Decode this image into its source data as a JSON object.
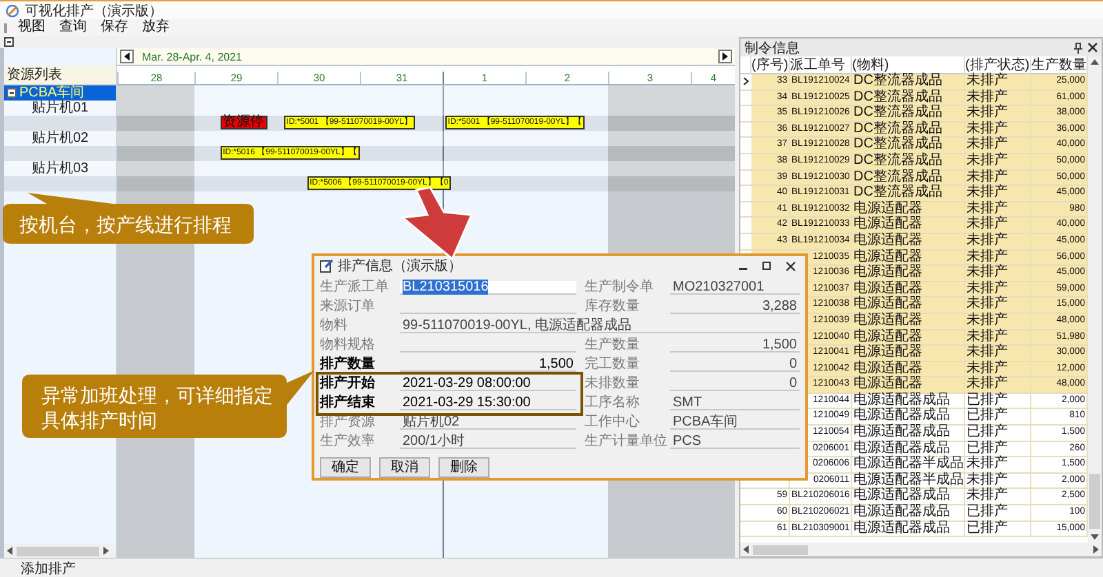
{
  "window": {
    "title": "可视化排产（演示版）"
  },
  "menu": [
    {
      "label": "视图"
    },
    {
      "label": "查询"
    },
    {
      "label": "保存"
    },
    {
      "label": "放弃"
    }
  ],
  "gantt": {
    "range": "Mar. 28-Apr. 4, 2021",
    "resource_header": "资源列表",
    "days": [
      {
        "label": "28",
        "shaded": true,
        "current": false
      },
      {
        "label": "29",
        "shaded": false,
        "current": false
      },
      {
        "label": "30",
        "shaded": false,
        "current": false
      },
      {
        "label": "31",
        "shaded": false,
        "current": false
      },
      {
        "label": "1",
        "shaded": false,
        "current": true
      },
      {
        "label": "2",
        "shaded": false,
        "current": false
      },
      {
        "label": "3",
        "shaded": true,
        "current": false
      },
      {
        "label": "4",
        "shaded": true,
        "current": false
      }
    ],
    "resources": [
      {
        "label": "PCBA车间",
        "selected": true,
        "expanded": true,
        "children": [
          {
            "label": "贴片机01",
            "selected": false,
            "bars": [
              {
                "kind": "stop",
                "label": "资源停"
              },
              {
                "kind": "job",
                "label": "ID:*5001 【99-511070019-00YL】"
              },
              {
                "kind": "job",
                "label": "ID:*5001 【99-511070019-00YL】【"
              }
            ]
          },
          {
            "label": "贴片机02",
            "selected": false,
            "bars": [
              {
                "kind": "job",
                "label": "ID:*5016 【99-511070019-00YL】【"
              }
            ]
          },
          {
            "label": "贴片机03",
            "selected": false,
            "bars": [
              {
                "kind": "job",
                "label": "ID:*5006 【99-511070019-00YL】【0"
              }
            ]
          }
        ]
      }
    ]
  },
  "callouts": [
    {
      "text": "按机台，按产线进行排程"
    },
    {
      "text": "异常加班处理，可详细指定具体排产时间"
    }
  ],
  "dialog": {
    "title": "排产信息（演示版）",
    "rows": [
      {
        "highlighted": false,
        "left": {
          "label": "生产派工单",
          "value": "BL210315016",
          "kind": "text",
          "disabled": true,
          "selected": true
        },
        "right": {
          "label": "生产制令单",
          "value": "MO210327001",
          "kind": "text",
          "disabled": true,
          "selected": false
        }
      },
      {
        "highlighted": false,
        "left": {
          "label": "来源订单",
          "kind": "text",
          "disabled": true,
          "selected": false
        },
        "right": {
          "label": "库存数量",
          "value": "3,288",
          "kind": "number",
          "disabled": true,
          "selected": false
        }
      },
      {
        "highlighted": false,
        "left": {
          "label": "物料",
          "value": "99-511070019-00YL, 电源适配器成品",
          "kind": "text",
          "disabled": true,
          "selected": false
        }
      },
      {
        "highlighted": false,
        "left": {
          "label": "物料规格",
          "kind": "text",
          "disabled": true,
          "selected": false
        },
        "right": {
          "label": "生产数量",
          "value": "1,500",
          "kind": "number",
          "disabled": true,
          "selected": false
        }
      },
      {
        "highlighted": false,
        "left": {
          "label": "排产数量",
          "value": "1,500",
          "kind": "number",
          "disabled": false,
          "selected": false
        },
        "right": {
          "label": "完工数量",
          "value": "0",
          "kind": "number",
          "disabled": true,
          "selected": false
        }
      },
      {
        "highlighted": true,
        "left": {
          "label": "排产开始",
          "value": "2021-03-29 08:00:00",
          "kind": "text",
          "disabled": false,
          "selected": false
        },
        "right": {
          "label": "未排数量",
          "value": "0",
          "kind": "number",
          "disabled": true,
          "selected": false
        }
      },
      {
        "highlighted": true,
        "left": {
          "label": "排产结束",
          "value": "2021-03-29 15:30:00",
          "kind": "text",
          "disabled": false,
          "selected": false
        },
        "right": {
          "label": "工序名称",
          "value": "SMT",
          "kind": "text",
          "disabled": true,
          "selected": false
        }
      },
      {
        "highlighted": false,
        "left": {
          "label": "排产资源",
          "value": "贴片机02",
          "kind": "text",
          "disabled": true,
          "selected": false
        },
        "right": {
          "label": "工作中心",
          "value": "PCBA车间",
          "kind": "text",
          "disabled": true,
          "selected": false
        }
      },
      {
        "highlighted": false,
        "left": {
          "label": "生产效率",
          "value": "200/1小时",
          "kind": "text",
          "disabled": true,
          "selected": false
        },
        "right": {
          "label": "生产计量单位",
          "value": "PCS",
          "kind": "text",
          "disabled": true,
          "selected": false
        }
      }
    ],
    "buttons": [
      "确定",
      "取消",
      "删除"
    ]
  },
  "orders": {
    "title": "制令信息",
    "columns": [
      "(序号)",
      "派工单号",
      "(物料)",
      "(排产状态)",
      "生产数量"
    ],
    "rows": [
      {
        "seq": "33",
        "order": "BL191210024",
        "material": "DC整流器成品",
        "status": "未排产",
        "qty": "25,000",
        "highlighted": true,
        "current": true
      },
      {
        "seq": "34",
        "order": "BL191210025",
        "material": "DC整流器成品",
        "status": "未排产",
        "qty": "61,000",
        "highlighted": true,
        "current": false
      },
      {
        "seq": "35",
        "order": "BL191210026",
        "material": "DC整流器成品",
        "status": "未排产",
        "qty": "38,000",
        "highlighted": true,
        "current": false
      },
      {
        "seq": "36",
        "order": "BL191210027",
        "material": "DC整流器成品",
        "status": "未排产",
        "qty": "36,000",
        "highlighted": true,
        "current": false
      },
      {
        "seq": "37",
        "order": "BL191210028",
        "material": "DC整流器成品",
        "status": "未排产",
        "qty": "40,000",
        "highlighted": true,
        "current": false
      },
      {
        "seq": "38",
        "order": "BL191210029",
        "material": "DC整流器成品",
        "status": "未排产",
        "qty": "50,000",
        "highlighted": true,
        "current": false
      },
      {
        "seq": "39",
        "order": "BL191210030",
        "material": "DC整流器成品",
        "status": "未排产",
        "qty": "50,000",
        "highlighted": true,
        "current": false
      },
      {
        "seq": "40",
        "order": "BL191210031",
        "material": "DC整流器成品",
        "status": "未排产",
        "qty": "45,000",
        "highlighted": true,
        "current": false
      },
      {
        "seq": "41",
        "order": "BL191210032",
        "material": "电源适配器",
        "status": "未排产",
        "qty": "980",
        "highlighted": true,
        "current": false
      },
      {
        "seq": "42",
        "order": "BL191210033",
        "material": "电源适配器",
        "status": "未排产",
        "qty": "40,000",
        "highlighted": true,
        "current": false
      },
      {
        "seq": "43",
        "order": "BL191210034",
        "material": "电源适配器",
        "status": "未排产",
        "qty": "45,000",
        "highlighted": true,
        "current": false
      },
      {
        "order": "1210035",
        "material": "电源适配器",
        "status": "未排产",
        "qty": "56,000",
        "highlighted": true
      },
      {
        "order": "1210036",
        "material": "电源适配器",
        "status": "未排产",
        "qty": "45,000",
        "highlighted": true
      },
      {
        "order": "1210037",
        "material": "电源适配器",
        "status": "未排产",
        "qty": "59,000",
        "highlighted": true
      },
      {
        "order": "1210038",
        "material": "电源适配器",
        "status": "未排产",
        "qty": "15,000",
        "highlighted": true
      },
      {
        "order": "1210039",
        "material": "电源适配器",
        "status": "未排产",
        "qty": "48,000",
        "highlighted": true
      },
      {
        "order": "1210040",
        "material": "电源适配器",
        "status": "未排产",
        "qty": "51,980",
        "highlighted": true
      },
      {
        "order": "1210041",
        "material": "电源适配器",
        "status": "未排产",
        "qty": "30,000",
        "highlighted": true
      },
      {
        "order": "1210042",
        "material": "电源适配器",
        "status": "未排产",
        "qty": "12,000",
        "highlighted": true
      },
      {
        "order": "1210043",
        "material": "电源适配器",
        "status": "未排产",
        "qty": "48,000",
        "highlighted": true
      },
      {
        "order": "1210044",
        "material": "电源适配器成品",
        "status": "已排产",
        "qty": "2,000",
        "highlighted": false
      },
      {
        "order": "1210049",
        "material": "电源适配器成品",
        "status": "已排产",
        "qty": "810",
        "highlighted": false
      },
      {
        "order": "1210054",
        "material": "电源适配器成品",
        "status": "已排产",
        "qty": "1,500",
        "highlighted": false
      },
      {
        "order": "0206001",
        "material": "电源适配器成品",
        "status": "已排产",
        "qty": "260",
        "highlighted": false
      },
      {
        "order": "0206006",
        "material": "电源适配器半成品",
        "status": "未排产",
        "qty": "1,500",
        "highlighted": false
      },
      {
        "order": "0206011",
        "material": "电源适配器半成品",
        "status": "未排产",
        "qty": "2,000",
        "highlighted": false
      },
      {
        "seq": "59",
        "order": "BL210206016",
        "material": "电源适配器成品",
        "status": "未排产",
        "qty": "2,500",
        "highlighted": false,
        "current": false
      },
      {
        "seq": "60",
        "order": "BL210206021",
        "material": "电源适配器成品",
        "status": "已排产",
        "qty": "100",
        "highlighted": false,
        "current": false
      },
      {
        "seq": "61",
        "order": "BL210309001",
        "material": "电源适配器成品",
        "status": "已排产",
        "qty": "15,000",
        "highlighted": false,
        "current": false
      }
    ]
  },
  "status_bar": {
    "text": "添加排产"
  }
}
